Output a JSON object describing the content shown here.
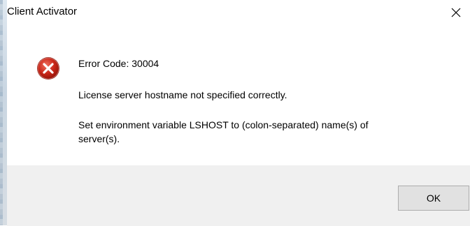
{
  "window": {
    "title": "Client Activator",
    "close_icon": "close-icon"
  },
  "message": {
    "icon": "error-icon",
    "error_code": "Error Code: 30004",
    "line1": "License server hostname not specified correctly.",
    "line2": "Set environment variable LSHOST to (colon-separated) name(s) of server(s)."
  },
  "buttons": {
    "ok_label": "OK"
  },
  "colors": {
    "error_red": "#c42b1c",
    "footer_bg": "#f0f0f0",
    "button_bg": "#e1e1e1",
    "button_border": "#adadad"
  }
}
